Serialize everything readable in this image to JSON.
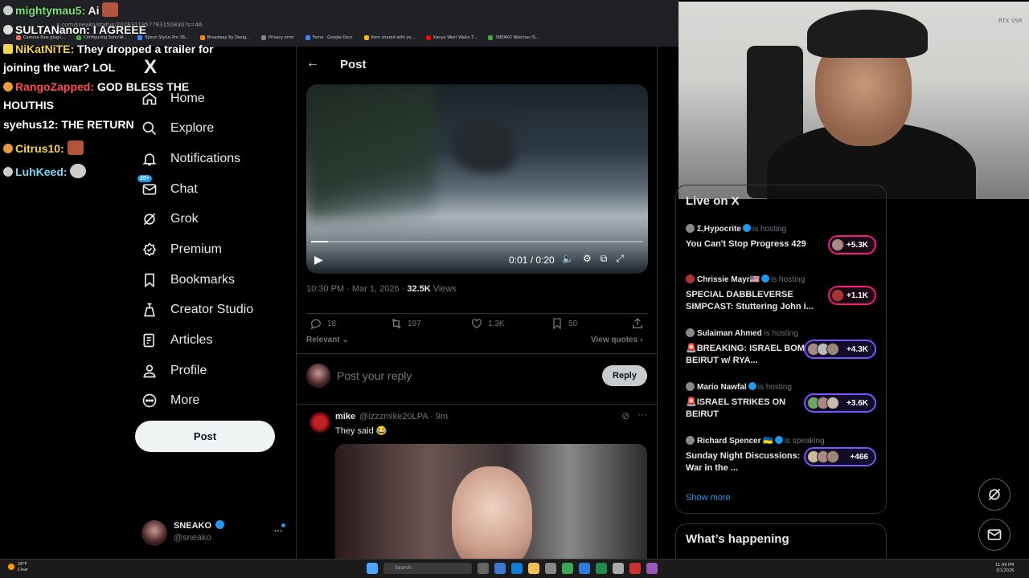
{
  "browser": {
    "url": "x.com/sneako/status/2028311957783150830?s=46",
    "bookmarks": [
      "Camera Raw plug-i...",
      "Configuring SonicW...",
      "Epson Stylus Pro 38...",
      "Broadway By Desig...",
      "Privacy error",
      "Fame - Google Docs",
      "Item shared with yo...",
      "Kanye West Walks T...",
      "SNEAKO Watches IS..."
    ]
  },
  "chat": [
    {
      "user": "mightymau5:",
      "text": "Ai",
      "color": "#7be27b"
    },
    {
      "user": "SULTANanon:",
      "text": "I AGREEE",
      "color": "#ffffff"
    },
    {
      "user": "NiKatNiTE:",
      "text": "They dropped a trailer for",
      "color": "#f7d54a"
    },
    {
      "user": "",
      "text": "joining the war? LOL",
      "color": "#ffffff"
    },
    {
      "user": "RangoZapped:",
      "text": "GOD BLESS THE",
      "color": "#ff4d4d"
    },
    {
      "user": "",
      "text": "HOUTHIS",
      "color": "#ffffff"
    },
    {
      "user": "syehus12:",
      "text": "THE RETURN",
      "color": "#ffffff"
    },
    {
      "user": "Citrus10:",
      "text": "",
      "color": "#f7d54a"
    },
    {
      "user": "LuhKeed:",
      "text": "",
      "color": "#7ad7f0"
    }
  ],
  "sidebar": {
    "logo": "X",
    "items": [
      {
        "label": "Home",
        "icon": "home-icon"
      },
      {
        "label": "Explore",
        "icon": "search-icon"
      },
      {
        "label": "Notifications",
        "icon": "bell-icon"
      },
      {
        "label": "Chat",
        "icon": "chat-icon",
        "badge": "20+"
      },
      {
        "label": "Grok",
        "icon": "grok-icon"
      },
      {
        "label": "Premium",
        "icon": "premium-icon"
      },
      {
        "label": "Bookmarks",
        "icon": "bookmark-icon"
      },
      {
        "label": "Creator Studio",
        "icon": "creator-studio-icon"
      },
      {
        "label": "Articles",
        "icon": "articles-icon"
      },
      {
        "label": "Profile",
        "icon": "profile-icon"
      },
      {
        "label": "More",
        "icon": "more-icon"
      }
    ],
    "post_button": "Post",
    "account": {
      "name": "SNEAKO",
      "handle": "@sneako",
      "more": "···"
    }
  },
  "post": {
    "back": "←",
    "title": "Post",
    "video": {
      "time": "0:01 / 0:20",
      "progress": 0.05
    },
    "timestamp": "10:30 PM · Mar 1, 2026 · ",
    "views_count": "32.5K",
    "views_label": " Views",
    "stats": {
      "replies": "18",
      "reposts": "197",
      "likes": "1.3K",
      "bookmarks": "50"
    },
    "sort": "Relevant",
    "view_quotes": "View quotes",
    "reply_placeholder": "Post your reply",
    "reply_button": "Reply"
  },
  "reply": {
    "name": "mike",
    "handle": "@izzzmike20LPA · 9m",
    "text": "They said 😂"
  },
  "webcam": {
    "overlay": "RTX VSR"
  },
  "live": {
    "title": "Live on X",
    "items": [
      {
        "host": "Σ,Hypocrite",
        "status": "is hosting",
        "title": "You Can't Stop Progress 429",
        "count": "+5.3K",
        "style": "pink"
      },
      {
        "host": "Chrissie Mayr🇺🇸",
        "status": "is hosting",
        "title": "SPECIAL DABBLEVERSE SIMPCAST: Stuttering John i...",
        "count": "+1.1K",
        "style": "pink"
      },
      {
        "host": "Sulaiman Ahmed",
        "status": "is hosting",
        "title": "🚨BREAKING: ISRAEL BOMB BEIRUT w/ RYA...",
        "count": "+4.3K",
        "style": "purple"
      },
      {
        "host": "Mario Nawfal",
        "status": "is hosting",
        "title": "🚨ISRAEL STRIKES ON BEIRUT",
        "count": "+3.6K",
        "style": "purple"
      },
      {
        "host": "Richard Spencer 🇺🇦",
        "status": "is speaking",
        "title": "Sunday Night Discussions: War in the ...",
        "count": "+466",
        "style": "purple"
      }
    ],
    "show_more": "Show more"
  },
  "whats_happening": "What’s happening",
  "taskbar": {
    "weather_temp": "28°F",
    "weather_desc": "Clear",
    "search": "Search",
    "time": "11:49 PM",
    "date": "3/1/2026"
  }
}
